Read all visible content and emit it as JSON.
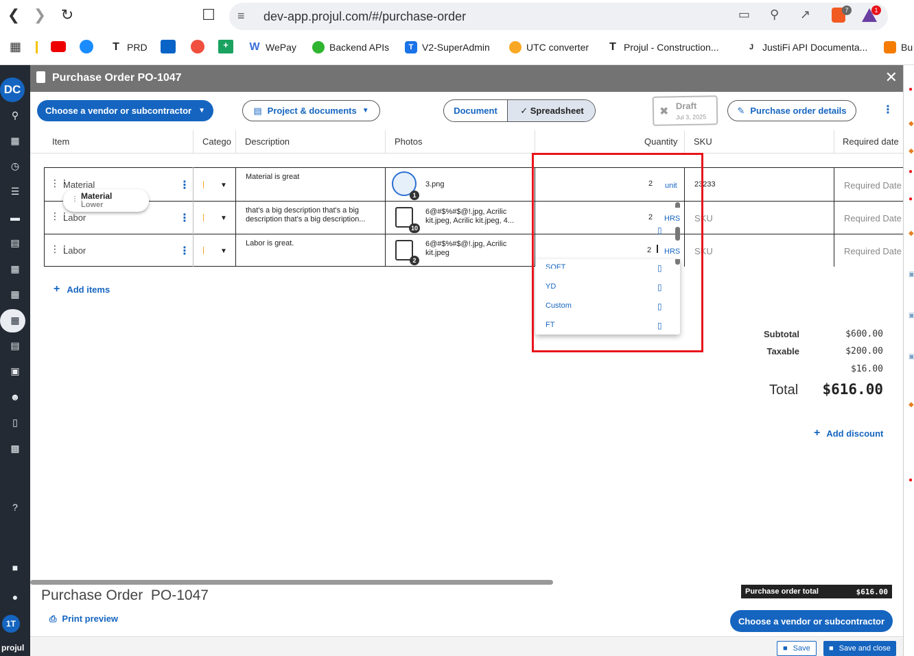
{
  "browser": {
    "url": "dev-app.projul.com/#/purchase-order",
    "bookmarks": [
      "PRD",
      "WePay",
      "Backend APIs",
      "V2-SuperAdmin",
      "UTC converter",
      "Projul - Construction...",
      "JustiFi API Documenta...",
      "Bu"
    ],
    "badges": {
      "brave": "7",
      "alert": "1"
    }
  },
  "rail": {
    "logo": "DC",
    "avatar": "1T",
    "brand": "projul"
  },
  "header": {
    "title": "Purchase Order PO-1047"
  },
  "toolbar": {
    "vendor_label": "Choose a vendor or subcontractor",
    "project_label": "Project & documents",
    "view_document": "Document",
    "view_spreadsheet": "Spreadsheet",
    "stamp_status": "Draft",
    "stamp_date": "Jul 3, 2025",
    "details_label": "Purchase order details"
  },
  "table": {
    "headers": {
      "item": "Item",
      "category": "Catego",
      "description": "Description",
      "photos": "Photos",
      "quantity": "Quantity",
      "sku": "SKU",
      "required_date": "Required date"
    },
    "rows": [
      {
        "item": "Material",
        "description": "Material is great",
        "photos": "3.png",
        "badge": "1",
        "quantity": "2",
        "unit": "unit",
        "sku": "23233",
        "required_date": "Required Date"
      },
      {
        "item": "Labor",
        "description": "that's a big description that's a big description that's a big description...",
        "photos": "6@#$%#$@!.jpg, Acrilic kit.jpeg, Acrilic kit.jpeg, 4...",
        "badge": "10",
        "quantity": "2",
        "unit": "HRS",
        "sku": "SKU",
        "required_date": "Required Date"
      },
      {
        "item": "Labor",
        "description": "Labor is great.",
        "photos": "6@#$%#$@!.jpg, Acrilic kit.jpeg",
        "badge": "2",
        "quantity": "2",
        "unit": "HRS",
        "sku": "SKU",
        "required_date": "Required Date"
      }
    ],
    "drag_chip": {
      "title": "Material",
      "subtitle": "Lower"
    },
    "add_items": "Add items"
  },
  "unit_menu": {
    "items": [
      "SQFT",
      "YD",
      "Custom",
      "FT"
    ]
  },
  "summary": {
    "subtotal_label": "Subtotal",
    "subtotal": "$600.00",
    "taxable_label": "Taxable",
    "taxable": "$200.00",
    "tax": "$16.00",
    "total_label": "Total",
    "total": "$616.00",
    "add_discount": "Add discount"
  },
  "footer": {
    "title": "Purchase Order  PO-1047",
    "print_preview": "Print preview",
    "po_total_label": "Purchase order total",
    "po_total": "$616.00",
    "vendor_label": "Choose a vendor or subcontractor",
    "save": "Save",
    "save_close": "Save and close"
  },
  "colors": {
    "primary": "#1565c0",
    "header": "#737373",
    "rail": "#232a33",
    "highlight": "#e8141b"
  }
}
